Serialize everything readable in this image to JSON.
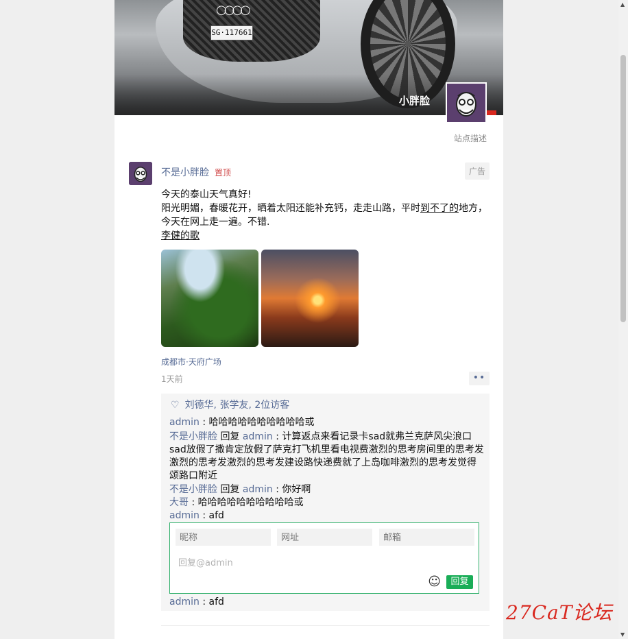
{
  "cover": {
    "plate_text": "SG·117661",
    "username": "小胖脸"
  },
  "site_description": "站点描述",
  "post": {
    "author": "不是小胖脸",
    "pinned_label": "置顶",
    "ad_label": "广告",
    "lines": [
      "今天的泰山天气真好!",
      "阳光明媚，春暖花开，晒着太阳还能补充钙，走走山路，平时",
      "到不了的",
      "地方，",
      "今天在网上走一遍。不错."
    ],
    "link_text": "李健的歌",
    "location": "成都市·天府广场",
    "time": "1天前",
    "more_label": "••"
  },
  "likes": {
    "text": "刘德华, 张学友, 2位访客"
  },
  "comments": [
    {
      "name": "admin",
      "sep": " : ",
      "text": "哈哈哈哈哈哈哈哈哈哈或"
    },
    {
      "name": "不是小胖脸",
      "reply_word": " 回复 ",
      "target": "admin",
      "sep": " : ",
      "text": "计算返点来看记录卡sad就弗兰克萨风尖浪口sad放假了撒肯定放假了萨克打飞机里看电视费激烈的思考房间里的思考发激烈的思考发激烈的思考发建设路快递费就了上岛咖啡激烈的思考发觉得颂路口附近"
    },
    {
      "name": "不是小胖脸",
      "reply_word": " 回复 ",
      "target": "admin",
      "sep": " : ",
      "text": "你好啊"
    },
    {
      "name": "大哥",
      "sep": " : ",
      "text": "哈哈哈哈哈哈哈哈哈哈或"
    },
    {
      "name": "admin",
      "sep": " : ",
      "text": "afd"
    },
    {
      "name": "admin",
      "sep": " : ",
      "text": "afd"
    }
  ],
  "reply_form": {
    "nickname_placeholder": "昵称",
    "website_placeholder": "网址",
    "email_placeholder": "邮箱",
    "reply_placeholder": "回复@admin",
    "submit_label": "回复"
  },
  "watermark": "27CaT论坛",
  "colors": {
    "link": "#576b95",
    "accent_green": "#19ad57",
    "pin_red": "#d04a4a",
    "avatar_bg": "#5b3f6e"
  }
}
